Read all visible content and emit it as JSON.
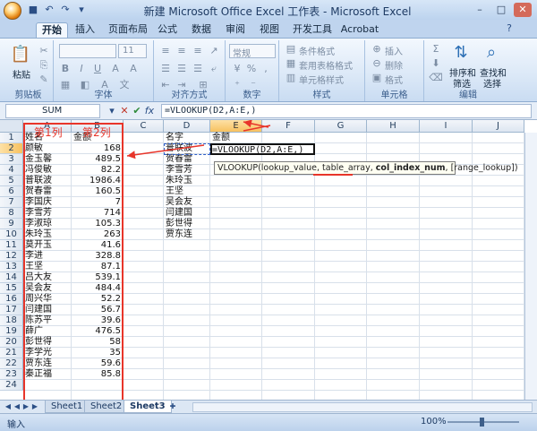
{
  "window": {
    "title": "新建 Microsoft Office Excel 工作表 - Microsoft Excel"
  },
  "tabs": [
    "开始",
    "插入",
    "页面布局",
    "公式",
    "数据",
    "审阅",
    "视图",
    "开发工具",
    "Acrobat"
  ],
  "ribbon": {
    "paste_label": "粘贴",
    "clipboard_label": "剪贴板",
    "font_size": "11",
    "font_label": "字体",
    "align_label": "对齐方式",
    "number_format": "常规",
    "number_label": "数字",
    "cond_format": "条件格式",
    "table_format": "套用表格格式",
    "cell_style": "单元格样式",
    "style_label": "样式",
    "insert": "插入",
    "delete": "删除",
    "format": "格式",
    "cells_label": "单元格",
    "sort_filter_line1": "排序和",
    "sort_filter_line2": "筛选",
    "find_select_line1": "查找和",
    "find_select_line2": "选择",
    "edit_label": "编辑",
    "percent": "%",
    "comma": ",",
    "sum_symbol": "Σ"
  },
  "formula_bar": {
    "name_box": "SUM",
    "fx": "fx",
    "formula": "=VLOOKUP(D2,A:E,)"
  },
  "columns": [
    "A",
    "B",
    "C",
    "D",
    "E",
    "F",
    "G",
    "H",
    "I",
    "J"
  ],
  "rows": [
    "1",
    "2",
    "3",
    "4",
    "5",
    "6",
    "7",
    "8",
    "9",
    "10",
    "11",
    "12",
    "13",
    "14",
    "15",
    "16",
    "17",
    "18",
    "19",
    "20",
    "21",
    "22",
    "23",
    "24"
  ],
  "table": {
    "header_name": "姓名",
    "header_amount": "金额",
    "names": [
      "颜敏",
      "金玉馨",
      "冯俊敏",
      "普联波",
      "贺春雷",
      "李国庆",
      "李雪芳",
      "李淑琼",
      "朱玲玉",
      "莫开玉",
      "李进",
      "王坚",
      "吕大友",
      "吴会友",
      "周兴华",
      "闫建国",
      "陈苏平",
      "薛广",
      "彭世得",
      "李学光",
      "贾东连",
      "秦正福"
    ],
    "amounts": [
      "168",
      "489.5",
      "82.2",
      "1986.4",
      "160.5",
      "7",
      "714",
      "105.3",
      "263",
      "41.6",
      "328.8",
      "87.1",
      "539.1",
      "484.4",
      "52.2",
      "56.7",
      "39.6",
      "476.5",
      "58",
      "35",
      "59.6",
      "85.8"
    ]
  },
  "lookup": {
    "header_name": "名字",
    "header_amount": "金额",
    "names": [
      "普联波",
      "贺春雷",
      "李雪芳",
      "朱玲玉",
      "王坚",
      "吴会友",
      "闫建国",
      "彭世得",
      "贾东连"
    ],
    "active_formula": "=VLOOKUP(D2,A:E,)"
  },
  "annotations": {
    "col1": "第1列",
    "col2": "第2列"
  },
  "tooltip": {
    "part1": "VLOOKUP(lookup_value, table_array, ",
    "bold": "col_index_num",
    "part2": ", [range_lookup])"
  },
  "sheets": [
    "Sheet1",
    "Sheet2",
    "Sheet3"
  ],
  "status": {
    "mode": "输入",
    "zoom": "100%"
  },
  "colors": {
    "annotation_red": "#e8352a",
    "ribbon_blue": "#bfd4ee"
  }
}
